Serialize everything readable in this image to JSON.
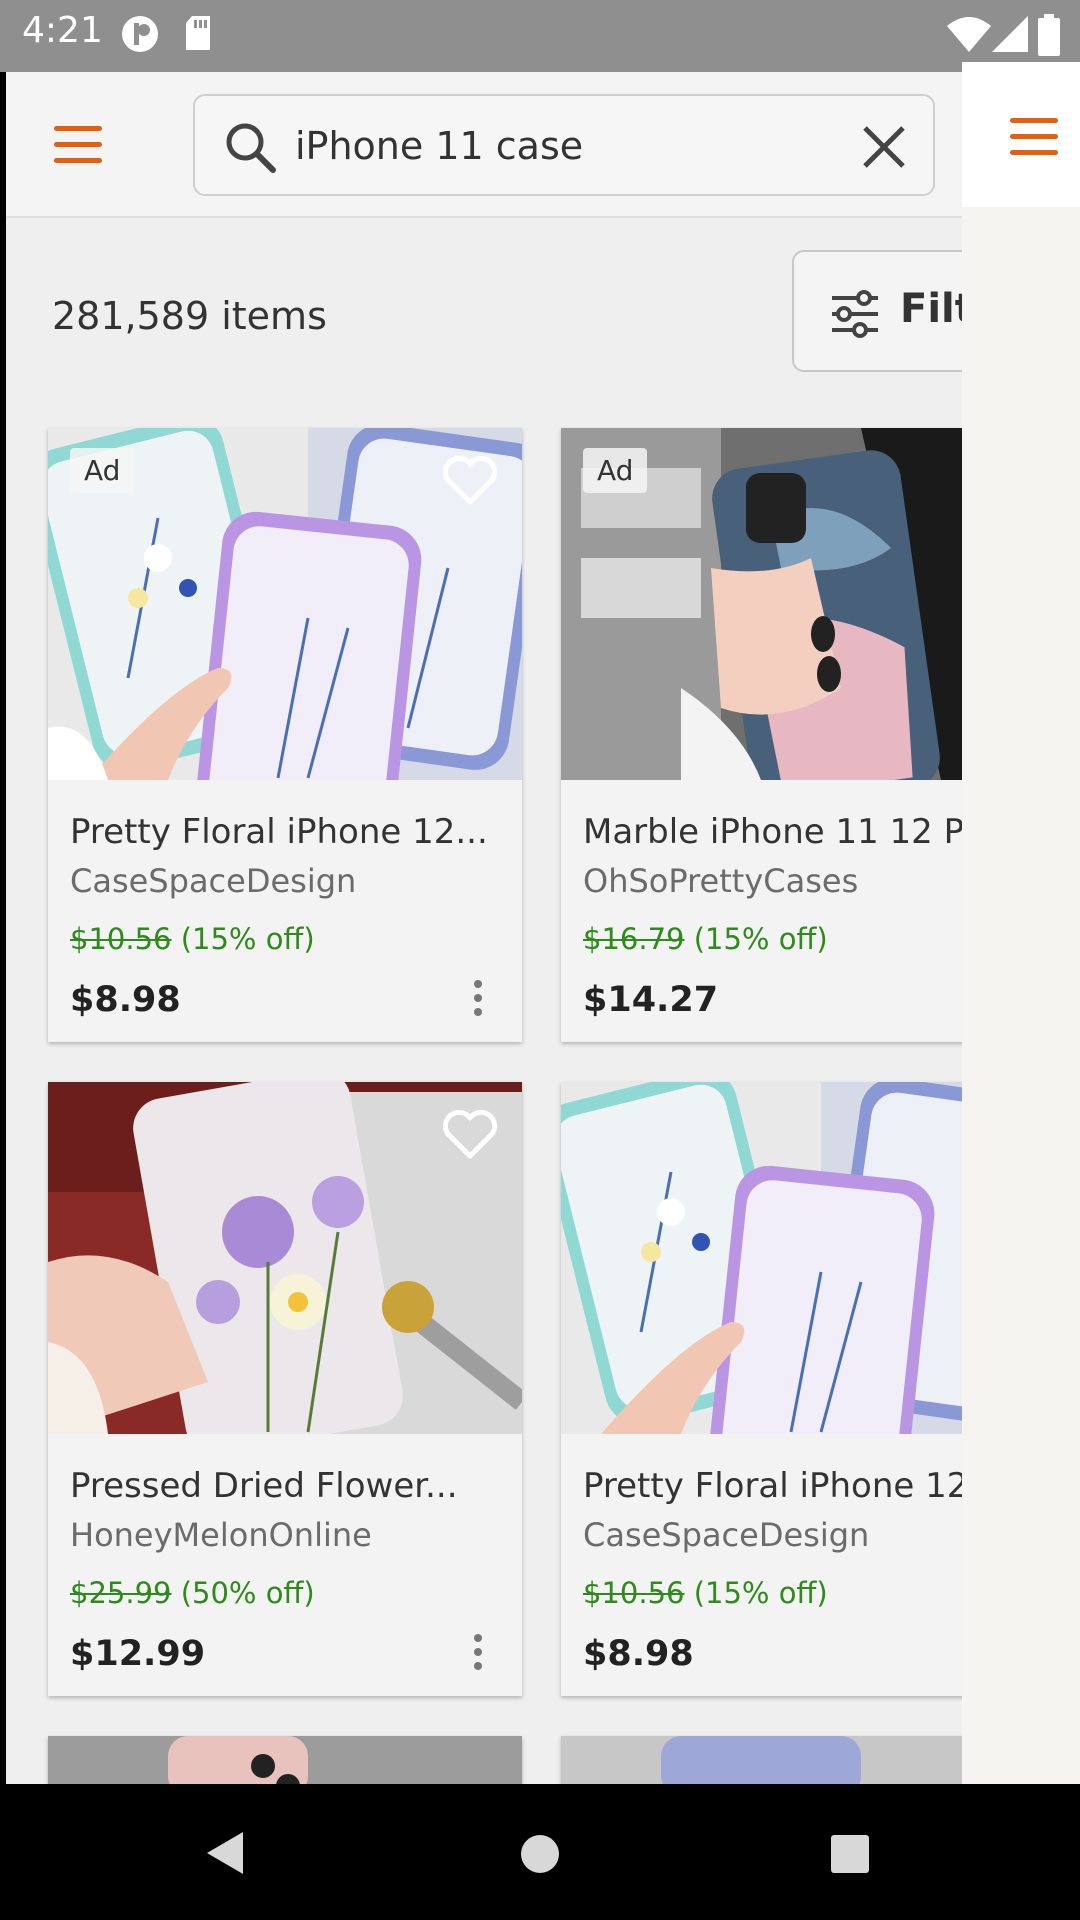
{
  "status_bar": {
    "time": "4:21"
  },
  "search": {
    "query": "iPhone 11 case"
  },
  "results": {
    "count_label": "281,589 items",
    "filter_label": "Filt"
  },
  "colors": {
    "accent": "#e2600f",
    "discount": "#2e8a1a"
  },
  "products": [
    {
      "title": "Pretty Floral iPhone 12...",
      "shop": "CaseSpaceDesign",
      "original_price": "$10.56",
      "discount": "(15% off)",
      "price": "$8.98",
      "ad": "Ad"
    },
    {
      "title": "Marble iPhone 11 12 Pr",
      "shop": "OhSoPrettyCases",
      "original_price": "$16.79",
      "discount": "(15% off)",
      "price": "$14.27",
      "ad": "Ad"
    },
    {
      "title": "Pressed Dried Flower...",
      "shop": "HoneyMelonOnline",
      "original_price": "$25.99",
      "discount": "(50% off)",
      "price": "$12.99"
    },
    {
      "title": "Pretty Floral iPhone 12",
      "shop": "CaseSpaceDesign",
      "original_price": "$10.56",
      "discount": "(15% off)",
      "price": "$8.98"
    }
  ],
  "icons": [
    "menu-icon",
    "search-icon",
    "close-icon",
    "filter-icon",
    "heart-icon",
    "more-vert-icon",
    "back-icon",
    "home-icon",
    "recents-icon",
    "wifi-icon",
    "signal-icon",
    "battery-icon",
    "sd-card-icon"
  ]
}
